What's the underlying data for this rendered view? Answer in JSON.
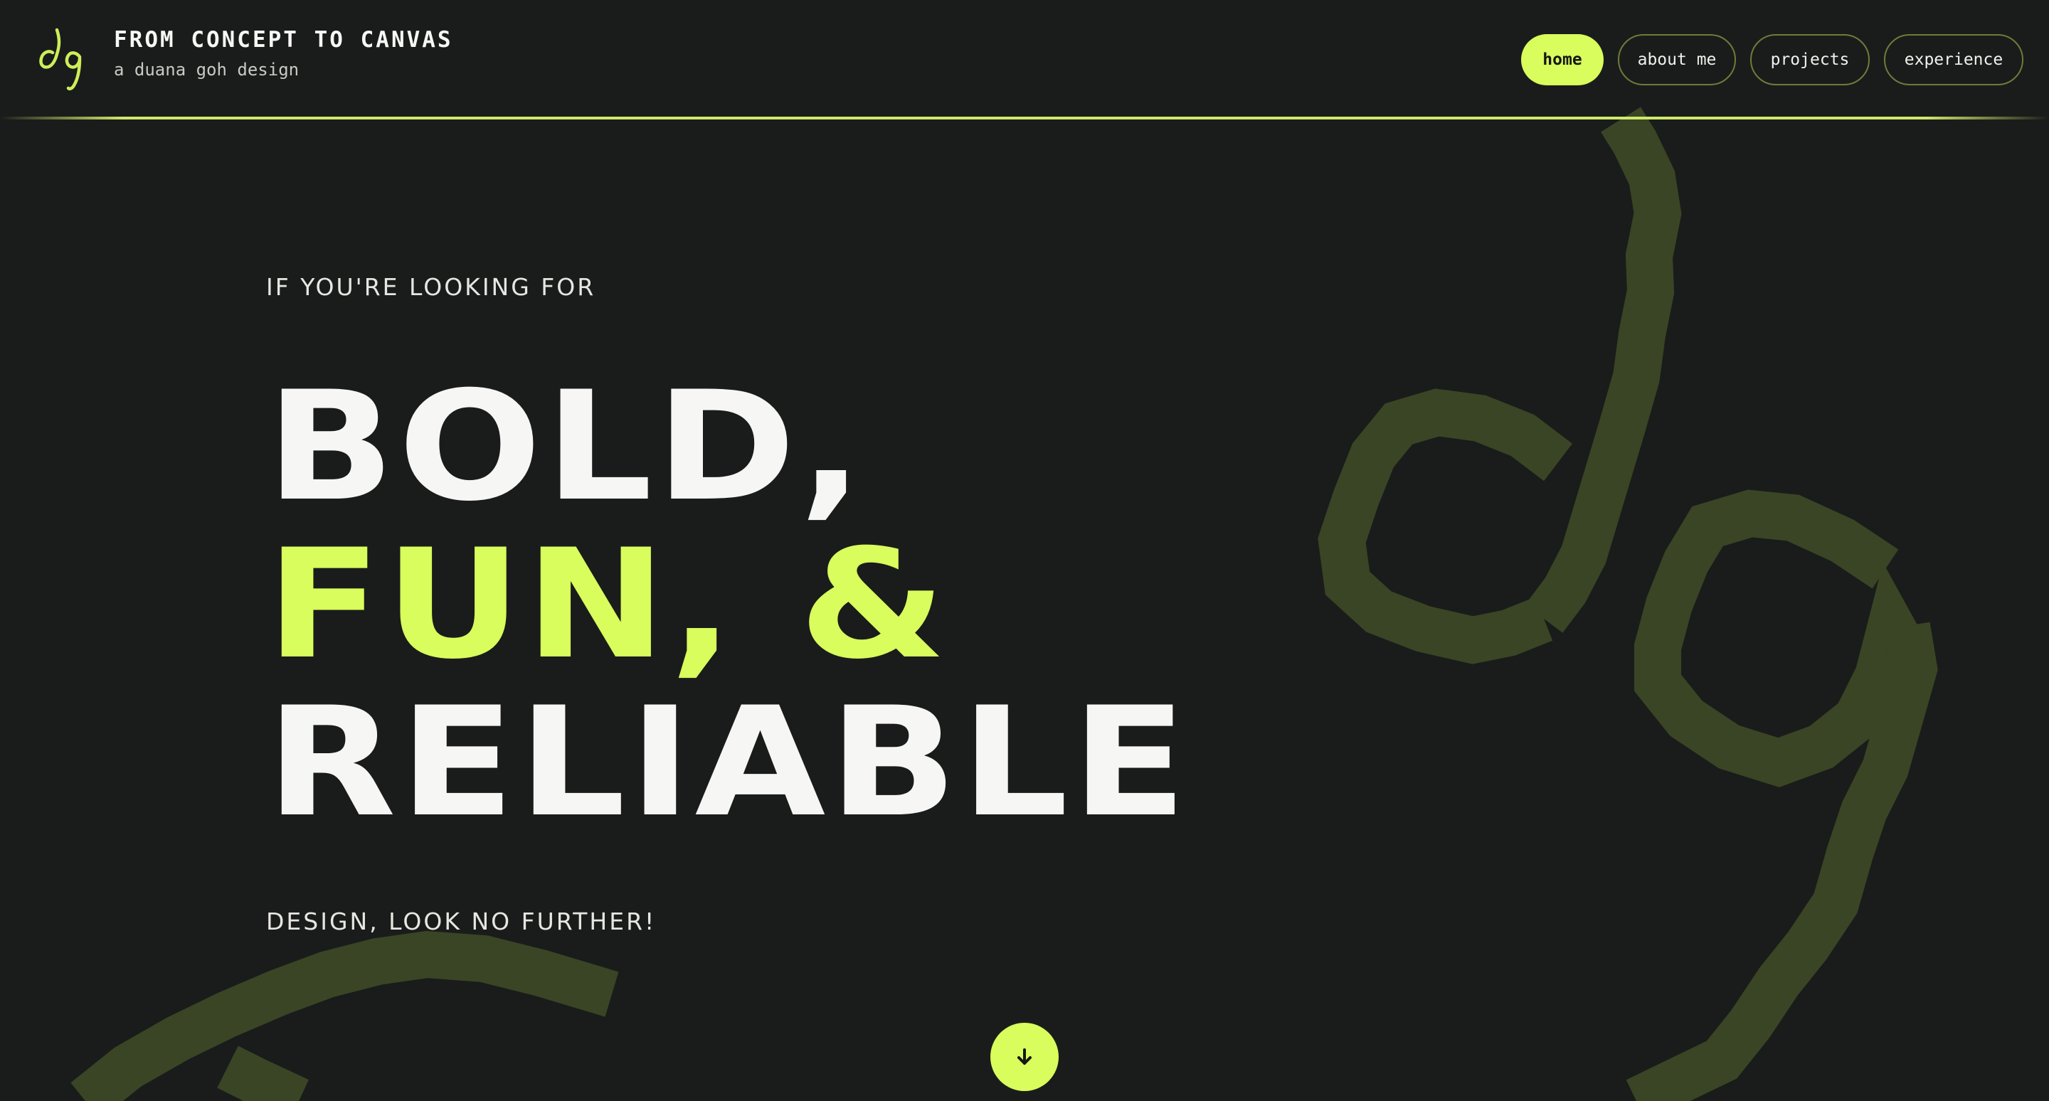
{
  "brand": {
    "logo_icon": "dg-monogram-logo",
    "title": "FROM CONCEPT TO CANVAS",
    "subtitle": "a duana goh design"
  },
  "nav": {
    "items": [
      {
        "label": "home",
        "active": true
      },
      {
        "label": "about me",
        "active": false
      },
      {
        "label": "projects",
        "active": false
      },
      {
        "label": "experience",
        "active": false
      }
    ]
  },
  "hero": {
    "eyebrow_top": "IF YOU'RE LOOKING FOR",
    "line1": "BOLD,",
    "line2": "FUN, &",
    "line3": "RELIABLE",
    "eyebrow_bottom": "DESIGN, LOOK NO FURTHER!"
  },
  "scroll_button": {
    "icon": "arrow-down-icon"
  },
  "colors": {
    "background": "#1a1c1b",
    "accent": "#d9fd5c",
    "text": "#f6f6f4",
    "art": "#394524"
  }
}
